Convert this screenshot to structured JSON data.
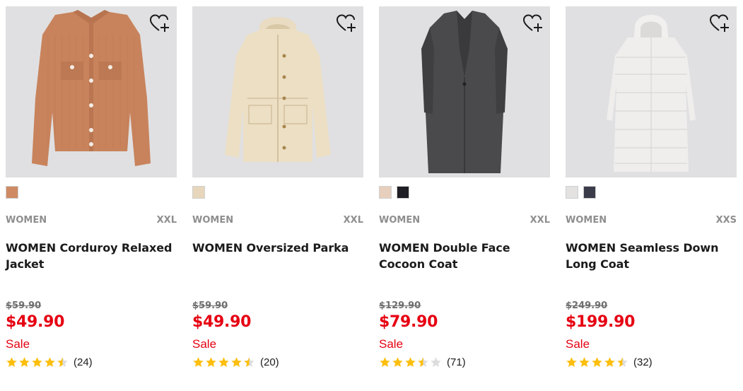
{
  "colors": {
    "sale_red": "#e60012",
    "star_gold": "#fcbf0f",
    "star_empty": "#dddddd",
    "image_bg": "#e0e0e2",
    "meta_gray": "#8e8e8e"
  },
  "products": [
    {
      "image": "corduroy-jacket",
      "swatches": [
        "#cf8a64"
      ],
      "gender": "WOMEN",
      "size": "XXL",
      "name": "WOMEN Corduroy Relaxed Jacket",
      "old_price": "$59.90",
      "price": "$49.90",
      "flag": "Sale",
      "rating": 4.5,
      "reviews": "(24)"
    },
    {
      "image": "oversized-parka",
      "swatches": [
        "#e7d6bb"
      ],
      "gender": "WOMEN",
      "size": "XXL",
      "name": "WOMEN Oversized Parka",
      "old_price": "$59.90",
      "price": "$49.90",
      "flag": "Sale",
      "rating": 4.5,
      "reviews": "(20)"
    },
    {
      "image": "double-face-cocoon-coat",
      "swatches": [
        "#e7cfbd",
        "#1f1e24"
      ],
      "gender": "WOMEN",
      "size": "XXL",
      "name": "WOMEN Double Face Cocoon Coat",
      "old_price": "$129.90",
      "price": "$79.90",
      "flag": "Sale",
      "rating": 3.5,
      "reviews": "(71)"
    },
    {
      "image": "seamless-down-long-coat",
      "swatches": [
        "#e4e2e1",
        "#3a3c4a"
      ],
      "gender": "WOMEN",
      "size": "XXS",
      "name": "WOMEN Seamless Down Long Coat",
      "old_price": "$249.90",
      "price": "$199.90",
      "flag": "Sale",
      "rating": 4.5,
      "reviews": "(32)"
    }
  ]
}
